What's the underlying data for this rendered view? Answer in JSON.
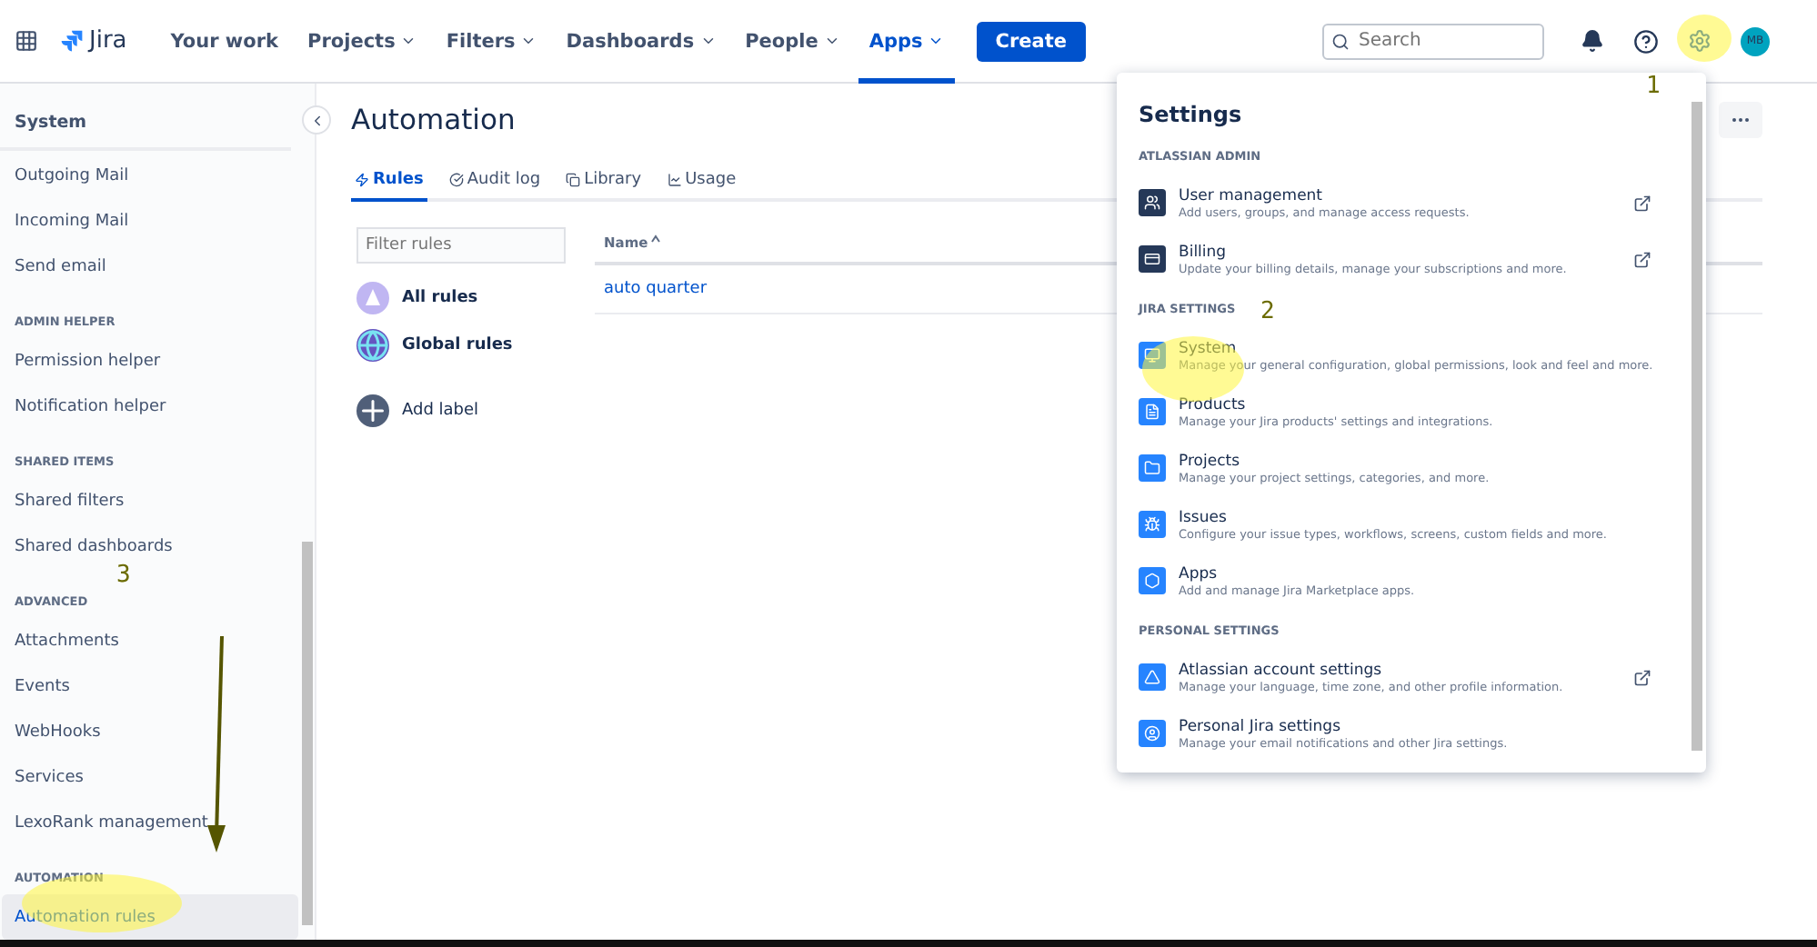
{
  "nav": {
    "logo": "Jira",
    "items": [
      {
        "label": "Your work",
        "dropdown": false,
        "selected": false
      },
      {
        "label": "Projects",
        "dropdown": true,
        "selected": false
      },
      {
        "label": "Filters",
        "dropdown": true,
        "selected": false
      },
      {
        "label": "Dashboards",
        "dropdown": true,
        "selected": false
      },
      {
        "label": "People",
        "dropdown": true,
        "selected": false
      },
      {
        "label": "Apps",
        "dropdown": true,
        "selected": true
      }
    ],
    "create": "Create",
    "search": {
      "placeholder": "Search"
    },
    "avatar": "MB"
  },
  "sidebar": {
    "title": "System",
    "sections": [
      {
        "items": [
          {
            "label": "Outgoing Mail",
            "selected": false
          },
          {
            "label": "Incoming Mail",
            "selected": false
          },
          {
            "label": "Send email",
            "selected": false
          }
        ]
      },
      {
        "heading": "ADMIN HELPER",
        "items": [
          {
            "label": "Permission helper",
            "selected": false
          },
          {
            "label": "Notification helper",
            "selected": false
          }
        ]
      },
      {
        "heading": "SHARED ITEMS",
        "items": [
          {
            "label": "Shared filters",
            "selected": false
          },
          {
            "label": "Shared dashboards",
            "selected": false
          }
        ]
      },
      {
        "heading": "ADVANCED",
        "items": [
          {
            "label": "Attachments",
            "selected": false
          },
          {
            "label": "Events",
            "selected": false
          },
          {
            "label": "WebHooks",
            "selected": false
          },
          {
            "label": "Services",
            "selected": false
          },
          {
            "label": "LexoRank management",
            "selected": false
          }
        ]
      },
      {
        "heading": "AUTOMATION",
        "items": [
          {
            "label": "Automation rules",
            "selected": true
          }
        ]
      }
    ]
  },
  "main": {
    "title": "Automation",
    "tabs": [
      {
        "label": "Rules",
        "selected": true
      },
      {
        "label": "Audit log",
        "selected": false
      },
      {
        "label": "Library",
        "selected": false
      },
      {
        "label": "Usage",
        "selected": false
      }
    ],
    "filter": {
      "placeholder": "Filter rules"
    },
    "labels": [
      {
        "label": "All rules",
        "kind": "all"
      },
      {
        "label": "Global rules",
        "kind": "global"
      },
      {
        "label": "Add label",
        "kind": "add"
      }
    ],
    "table": {
      "columns": [
        "Name"
      ],
      "rows": [
        [
          "auto quarter"
        ]
      ]
    }
  },
  "settings": {
    "title": "Settings",
    "sections": [
      {
        "heading": "ATLASSIAN ADMIN",
        "items": [
          {
            "title": "User management",
            "description": "Add users, groups, and manage access requests.",
            "external": true
          },
          {
            "title": "Billing",
            "description": "Update your billing details, manage your subscriptions and more.",
            "external": true
          }
        ]
      },
      {
        "heading": "JIRA SETTINGS",
        "items": [
          {
            "title": "System",
            "description": "Manage your general configuration, global permissions, look and feel and more.",
            "external": false
          },
          {
            "title": "Products",
            "description": "Manage your Jira products' settings and integrations.",
            "external": false
          },
          {
            "title": "Projects",
            "description": "Manage your project settings, categories, and more.",
            "external": false
          },
          {
            "title": "Issues",
            "description": "Configure your issue types, workflows, screens, custom fields and more.",
            "external": false
          },
          {
            "title": "Apps",
            "description": "Add and manage Jira Marketplace apps.",
            "external": false
          }
        ]
      },
      {
        "heading": "PERSONAL SETTINGS",
        "items": [
          {
            "title": "Atlassian account settings",
            "description": "Manage your language, time zone, and other profile information.",
            "external": true
          },
          {
            "title": "Personal Jira settings",
            "description": "Manage your email notifications and other Jira settings.",
            "external": false
          }
        ]
      }
    ]
  },
  "annotations": [
    "1",
    "2",
    "3"
  ]
}
